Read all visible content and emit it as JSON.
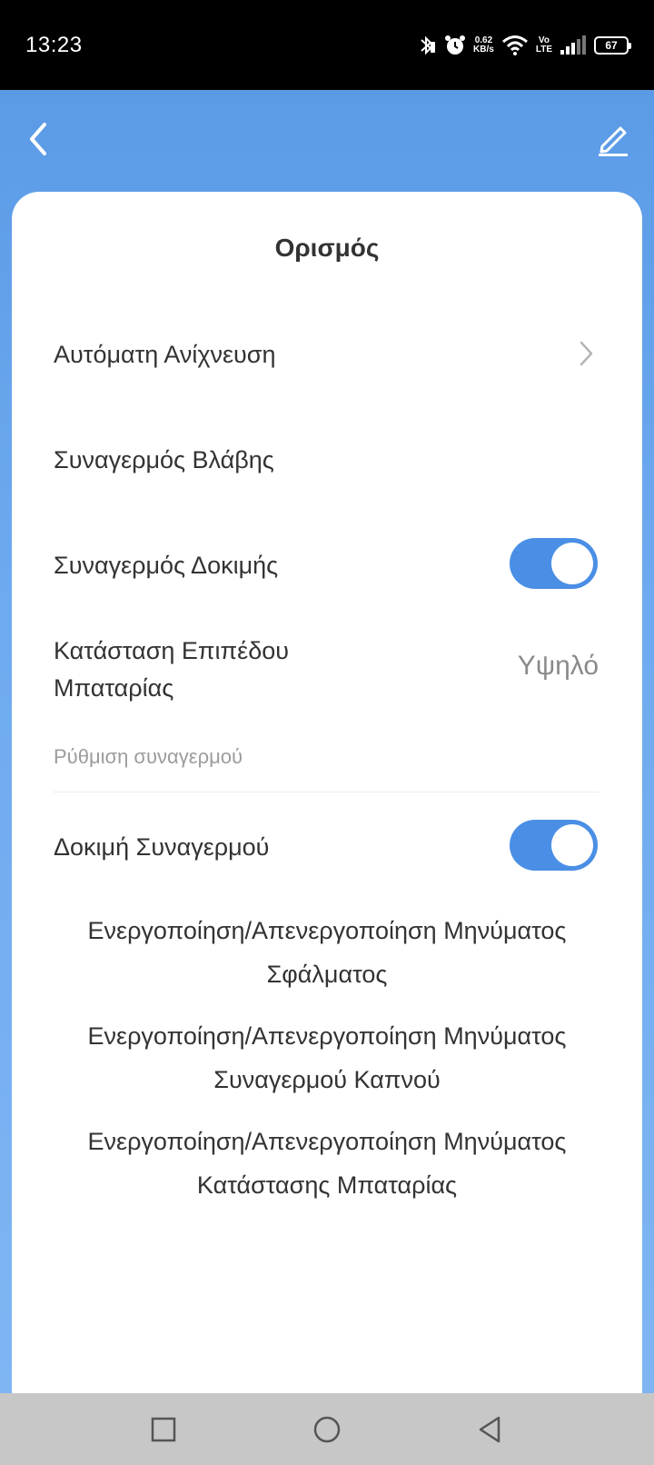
{
  "status_bar": {
    "time": "13:23",
    "net_speed_value": "0.62",
    "net_speed_unit": "KB/s",
    "volte_top": "Vo",
    "volte_bottom": "LTE",
    "battery": "67"
  },
  "header": {
    "back_icon": "chevron-left-icon",
    "edit_icon": "pencil-icon"
  },
  "card": {
    "title": "Ορισμός",
    "items": [
      {
        "label": "Αυτόματη Ανίχνευση",
        "control": "chevron"
      },
      {
        "label": "Συναγερμός Βλάβης",
        "control": "none"
      },
      {
        "label": "Συναγερμός Δοκιμής",
        "control": "toggle",
        "on": true
      },
      {
        "label_line1": "Κατάσταση Επιπέδου",
        "label_line2": "Μπαταρίας",
        "value": "Υψηλό"
      }
    ],
    "section_header": "Ρύθμιση συναγερμού",
    "alarm_test": {
      "label": "Δοκιμή Συναγερμού",
      "on": true
    },
    "messages": [
      {
        "line1": "Ενεργοποίηση/Απενεργοποίηση Μηνύματος",
        "line2": "Σφάλματος"
      },
      {
        "line1": "Ενεργοποίηση/Απενεργοποίηση Μηνύματος",
        "line2": "Συναγερμού Καπνού"
      },
      {
        "line1": "Ενεργοποίηση/Απενεργοποίηση Μηνύματος",
        "line2": "Κατάστασης Μπαταρίας"
      }
    ]
  },
  "colors": {
    "accent": "#4a8fe5",
    "header_gradient_top": "#5b9be6",
    "nav_bar": "#c7c7c7"
  },
  "nav": {
    "recents_icon": "square-icon",
    "home_icon": "circle-icon",
    "back_icon": "triangle-back-icon"
  }
}
